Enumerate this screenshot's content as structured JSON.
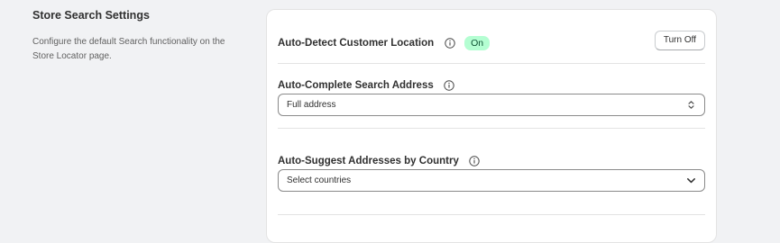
{
  "section": {
    "title": "Store Search Settings",
    "description": "Configure the default Search functionality on the Store Locator page."
  },
  "auto_detect": {
    "label": "Auto-Detect Customer Location",
    "status": "On",
    "button_label": "Turn Off"
  },
  "auto_complete": {
    "label": "Auto-Complete Search Address",
    "selected": "Full address"
  },
  "auto_suggest": {
    "label": "Auto-Suggest Addresses by Country",
    "placeholder": "Select countries"
  },
  "colors": {
    "status_on_bg": "#b4fed2",
    "status_on_text": "#0c5132"
  },
  "icons": [
    "info-icon",
    "select-arrows-icon",
    "chevron-down-icon"
  ]
}
